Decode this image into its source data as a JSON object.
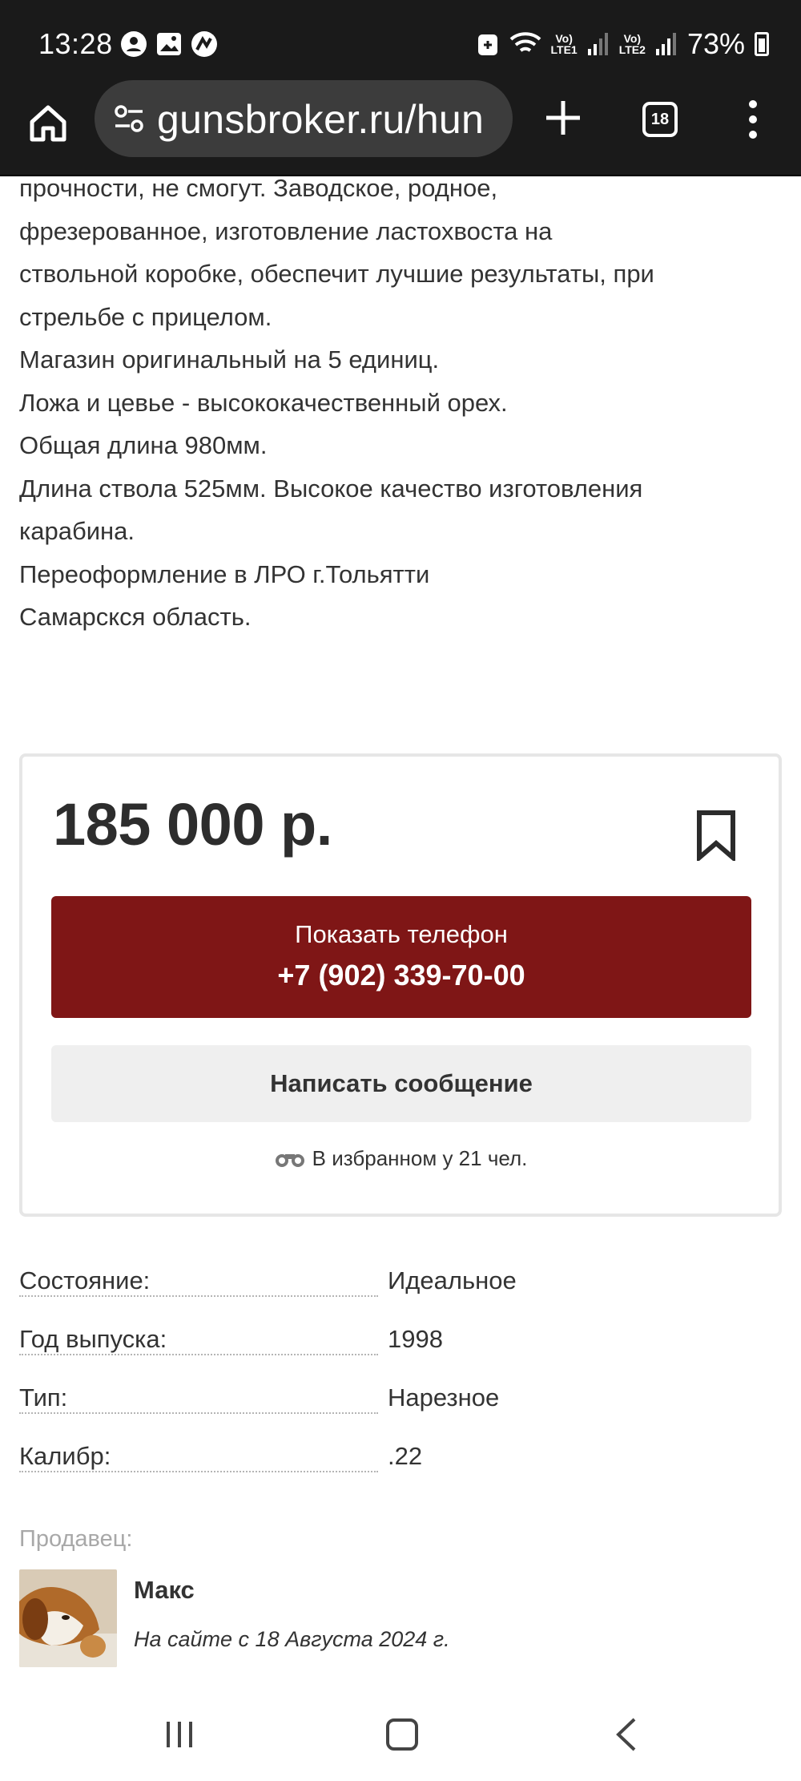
{
  "status_bar": {
    "time": "13:28",
    "net1": "LTE1",
    "net2": "LTE2",
    "battery": "73%"
  },
  "browser": {
    "url": "gunsbroker.ru/hun",
    "tab_count": "18"
  },
  "description": [
    "прочности, не смогут. Заводское, родное,",
    "фрезерованное, изготовление ластохвоста на",
    "ствольной коробке, обеспечит лучшие результаты, при",
    "стрельбе с прицелом.",
    "Магазин оригинальный на 5 единиц.",
    "Ложа и цевье - высококачественный орех.",
    "Общая длина 980мм.",
    "Длина ствола 525мм. Высокое качество изготовления",
    "карабина.",
    "Переоформление в ЛРО г.Тольятти",
    "Самарскся область."
  ],
  "price_card": {
    "price": "185 000 р.",
    "show_phone_label": "Показать телефон",
    "phone": "+7 (902) 339-70-00",
    "message_label": "Написать сообщение",
    "favorites_text": "В избранном у 21 чел."
  },
  "specs": [
    {
      "label": "Состояние:",
      "value": "Идеальное"
    },
    {
      "label": "Год выпуска:",
      "value": "1998"
    },
    {
      "label": "Тип:",
      "value": "Нарезное"
    },
    {
      "label": "Калибр:",
      "value": ".22"
    }
  ],
  "seller": {
    "section_label": "Продавец:",
    "name": "Макс",
    "since": "На сайте с 18 Августа 2024 г."
  },
  "colors": {
    "phone_button": "#7f1616",
    "message_button": "#efefef",
    "status_bar": "#1a1a1a"
  }
}
